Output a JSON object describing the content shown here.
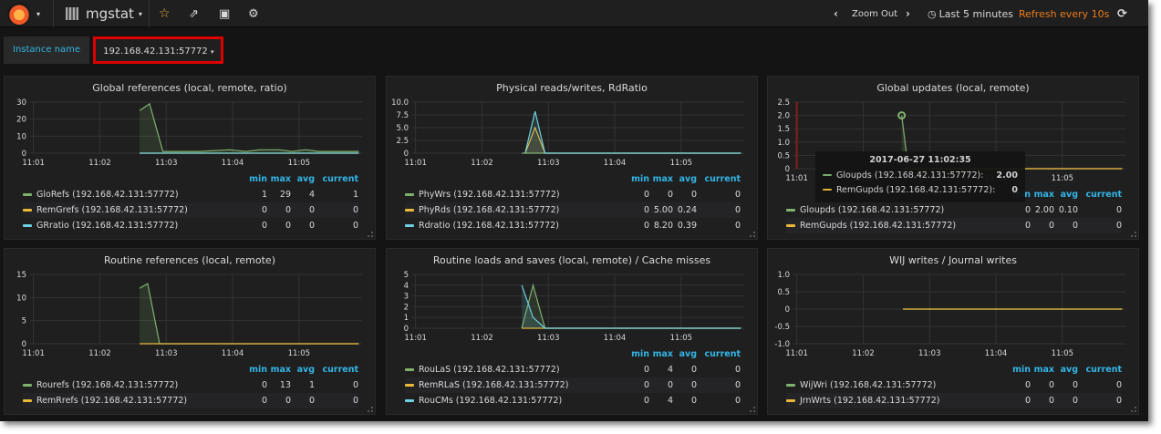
{
  "nav": {
    "dashboard_title": "mgstat",
    "zoom_out": "Zoom Out",
    "time_range": "Last 5 minutes",
    "refresh": "Refresh every 10s"
  },
  "variables": {
    "label": "Instance name",
    "value": "192.168.42.131:57772"
  },
  "legend_headers": [
    "min",
    "max",
    "avg",
    "current"
  ],
  "colors": {
    "green": "#7eb26d",
    "yellow": "#eab839",
    "cyan": "#6ed0e0",
    "annotation": "#8b1a1a"
  },
  "tooltip": {
    "time": "2017-06-27 11:02:35",
    "rows": [
      {
        "name": "Gloupds (192.168.42.131:57772):",
        "value": "2.00",
        "color": "#7eb26d"
      },
      {
        "name": "RemGupds (192.168.42.131:57772):",
        "value": "0",
        "color": "#eab839"
      }
    ]
  },
  "chart_data": [
    {
      "type": "line",
      "title": "Global references (local, remote, ratio)",
      "ylim": [
        0,
        30
      ],
      "yticks": [
        "0",
        "10",
        "20",
        "30"
      ],
      "xticks": [
        "11:01",
        "11:02",
        "11:03",
        "11:04",
        "11:05"
      ],
      "series": [
        {
          "name": "GloRefs (192.168.42.131:57772)",
          "color": "#7eb26d",
          "fill": true,
          "points": [
            [
              2.6,
              25
            ],
            [
              2.75,
              29
            ],
            [
              2.95,
              1
            ],
            [
              3.5,
              1
            ],
            [
              3.95,
              2
            ],
            [
              4.2,
              1
            ],
            [
              4.4,
              2
            ],
            [
              4.7,
              2
            ],
            [
              4.9,
              1
            ],
            [
              5.1,
              2
            ],
            [
              5.3,
              1
            ],
            [
              5.9,
              1
            ]
          ],
          "stats": [
            "1",
            "29",
            "4",
            "1"
          ]
        },
        {
          "name": "RemGrefs (192.168.42.131:57772)",
          "color": "#eab839",
          "points": [
            [
              2.6,
              0
            ],
            [
              5.9,
              0
            ]
          ],
          "stats": [
            "0",
            "0",
            "0",
            "0"
          ]
        },
        {
          "name": "GRratio (192.168.42.131:57772)",
          "color": "#6ed0e0",
          "points": [
            [
              2.6,
              0
            ],
            [
              5.9,
              0
            ]
          ],
          "stats": [
            "0",
            "0",
            "0",
            "0"
          ]
        }
      ]
    },
    {
      "type": "line",
      "title": "Physical reads/writes, RdRatio",
      "ylim": [
        0,
        10
      ],
      "yticks": [
        "0",
        "2.5",
        "5.0",
        "7.5",
        "10.0"
      ],
      "xticks": [
        "11:01",
        "11:02",
        "11:03",
        "11:04",
        "11:05"
      ],
      "series": [
        {
          "name": "PhyWrs (192.168.42.131:57772)",
          "color": "#7eb26d",
          "points": [
            [
              2.6,
              0
            ],
            [
              5.9,
              0
            ]
          ],
          "stats": [
            "0",
            "0",
            "0",
            "0"
          ]
        },
        {
          "name": "PhyRds (192.168.42.131:57772)",
          "color": "#eab839",
          "fill": true,
          "points": [
            [
              2.65,
              0
            ],
            [
              2.8,
              5
            ],
            [
              2.95,
              0
            ],
            [
              5.9,
              0
            ]
          ],
          "stats": [
            "0",
            "5.00",
            "0.24",
            "0"
          ]
        },
        {
          "name": "Rdratio (192.168.42.131:57772)",
          "color": "#6ed0e0",
          "fill": true,
          "points": [
            [
              2.65,
              0
            ],
            [
              2.8,
              8.2
            ],
            [
              2.95,
              0
            ],
            [
              5.9,
              0
            ]
          ],
          "stats": [
            "0",
            "8.20",
            "0.39",
            "0"
          ]
        }
      ]
    },
    {
      "type": "line",
      "title": "Global updates (local, remote)",
      "ylim": [
        0,
        2.5
      ],
      "yticks": [
        "0",
        "0.5",
        "1.0",
        "1.5",
        "2.0",
        "2.5"
      ],
      "xticks": [
        "11:01",
        "11:02",
        "11:03",
        "11:04",
        "11:05"
      ],
      "annotation_x": 1.0,
      "hover_point": [
        2.58,
        2
      ],
      "series": [
        {
          "name": "Gloupds (192.168.42.131:57772)",
          "color": "#7eb26d",
          "fill": true,
          "points": [
            [
              2.58,
              2
            ],
            [
              2.68,
              0
            ],
            [
              5.9,
              0
            ]
          ],
          "stats": [
            "0",
            "2.00",
            "0.10",
            "0"
          ]
        },
        {
          "name": "RemGupds (192.168.42.131:57772)",
          "color": "#eab839",
          "points": [
            [
              2.6,
              0
            ],
            [
              5.9,
              0
            ]
          ],
          "stats": [
            "0",
            "0",
            "0",
            "0"
          ]
        }
      ]
    },
    {
      "type": "line",
      "title": "Routine references (local, remote)",
      "ylim": [
        0,
        15
      ],
      "yticks": [
        "0",
        "5",
        "10",
        "15"
      ],
      "xticks": [
        "11:01",
        "11:02",
        "11:03",
        "11:04",
        "11:05"
      ],
      "series": [
        {
          "name": "Rourefs (192.168.42.131:57772)",
          "color": "#7eb26d",
          "fill": true,
          "points": [
            [
              2.6,
              12
            ],
            [
              2.72,
              13
            ],
            [
              2.9,
              0
            ],
            [
              5.9,
              0
            ]
          ],
          "stats": [
            "0",
            "13",
            "1",
            "0"
          ]
        },
        {
          "name": "RemRrefs (192.168.42.131:57772)",
          "color": "#eab839",
          "points": [
            [
              2.6,
              0
            ],
            [
              5.9,
              0
            ]
          ],
          "stats": [
            "0",
            "0",
            "0",
            "0"
          ]
        }
      ]
    },
    {
      "type": "line",
      "title": "Routine loads and saves (local, remote) / Cache misses",
      "ylim": [
        0,
        5
      ],
      "yticks": [
        "0",
        "1",
        "2",
        "3",
        "4",
        "5"
      ],
      "xticks": [
        "11:01",
        "11:02",
        "11:03",
        "11:04",
        "11:05"
      ],
      "series": [
        {
          "name": "RouLaS (192.168.42.131:57772)",
          "color": "#7eb26d",
          "fill": true,
          "points": [
            [
              2.6,
              0
            ],
            [
              2.77,
              4
            ],
            [
              2.95,
              0
            ],
            [
              5.9,
              0
            ]
          ],
          "stats": [
            "0",
            "4",
            "0",
            "0"
          ]
        },
        {
          "name": "RemRLaS (192.168.42.131:57772)",
          "color": "#eab839",
          "points": [
            [
              2.6,
              0
            ],
            [
              5.9,
              0
            ]
          ],
          "stats": [
            "0",
            "0",
            "0",
            "0"
          ]
        },
        {
          "name": "RouCMs (192.168.42.131:57772)",
          "color": "#6ed0e0",
          "fill": true,
          "points": [
            [
              2.6,
              4
            ],
            [
              2.77,
              1
            ],
            [
              2.95,
              0
            ],
            [
              5.9,
              0
            ]
          ],
          "stats": [
            "0",
            "4",
            "0",
            "0"
          ]
        }
      ]
    },
    {
      "type": "line",
      "title": "WIJ writes / Journal writes",
      "ylim": [
        -1,
        1
      ],
      "yticks": [
        "-1.0",
        "-0.5",
        "0",
        "0.5",
        "1.0"
      ],
      "xticks": [
        "11:01",
        "11:02",
        "11:03",
        "11:04",
        "11:05"
      ],
      "series": [
        {
          "name": "WijWri (192.168.42.131:57772)",
          "color": "#7eb26d",
          "points": [
            [
              2.6,
              0
            ],
            [
              5.9,
              0
            ]
          ],
          "stats": [
            "0",
            "0",
            "0",
            "0"
          ]
        },
        {
          "name": "JrnWrts (192.168.42.131:57772)",
          "color": "#eab839",
          "points": [
            [
              2.6,
              0
            ],
            [
              5.9,
              0
            ]
          ],
          "stats": [
            "0",
            "0",
            "0",
            "0"
          ]
        }
      ]
    }
  ]
}
